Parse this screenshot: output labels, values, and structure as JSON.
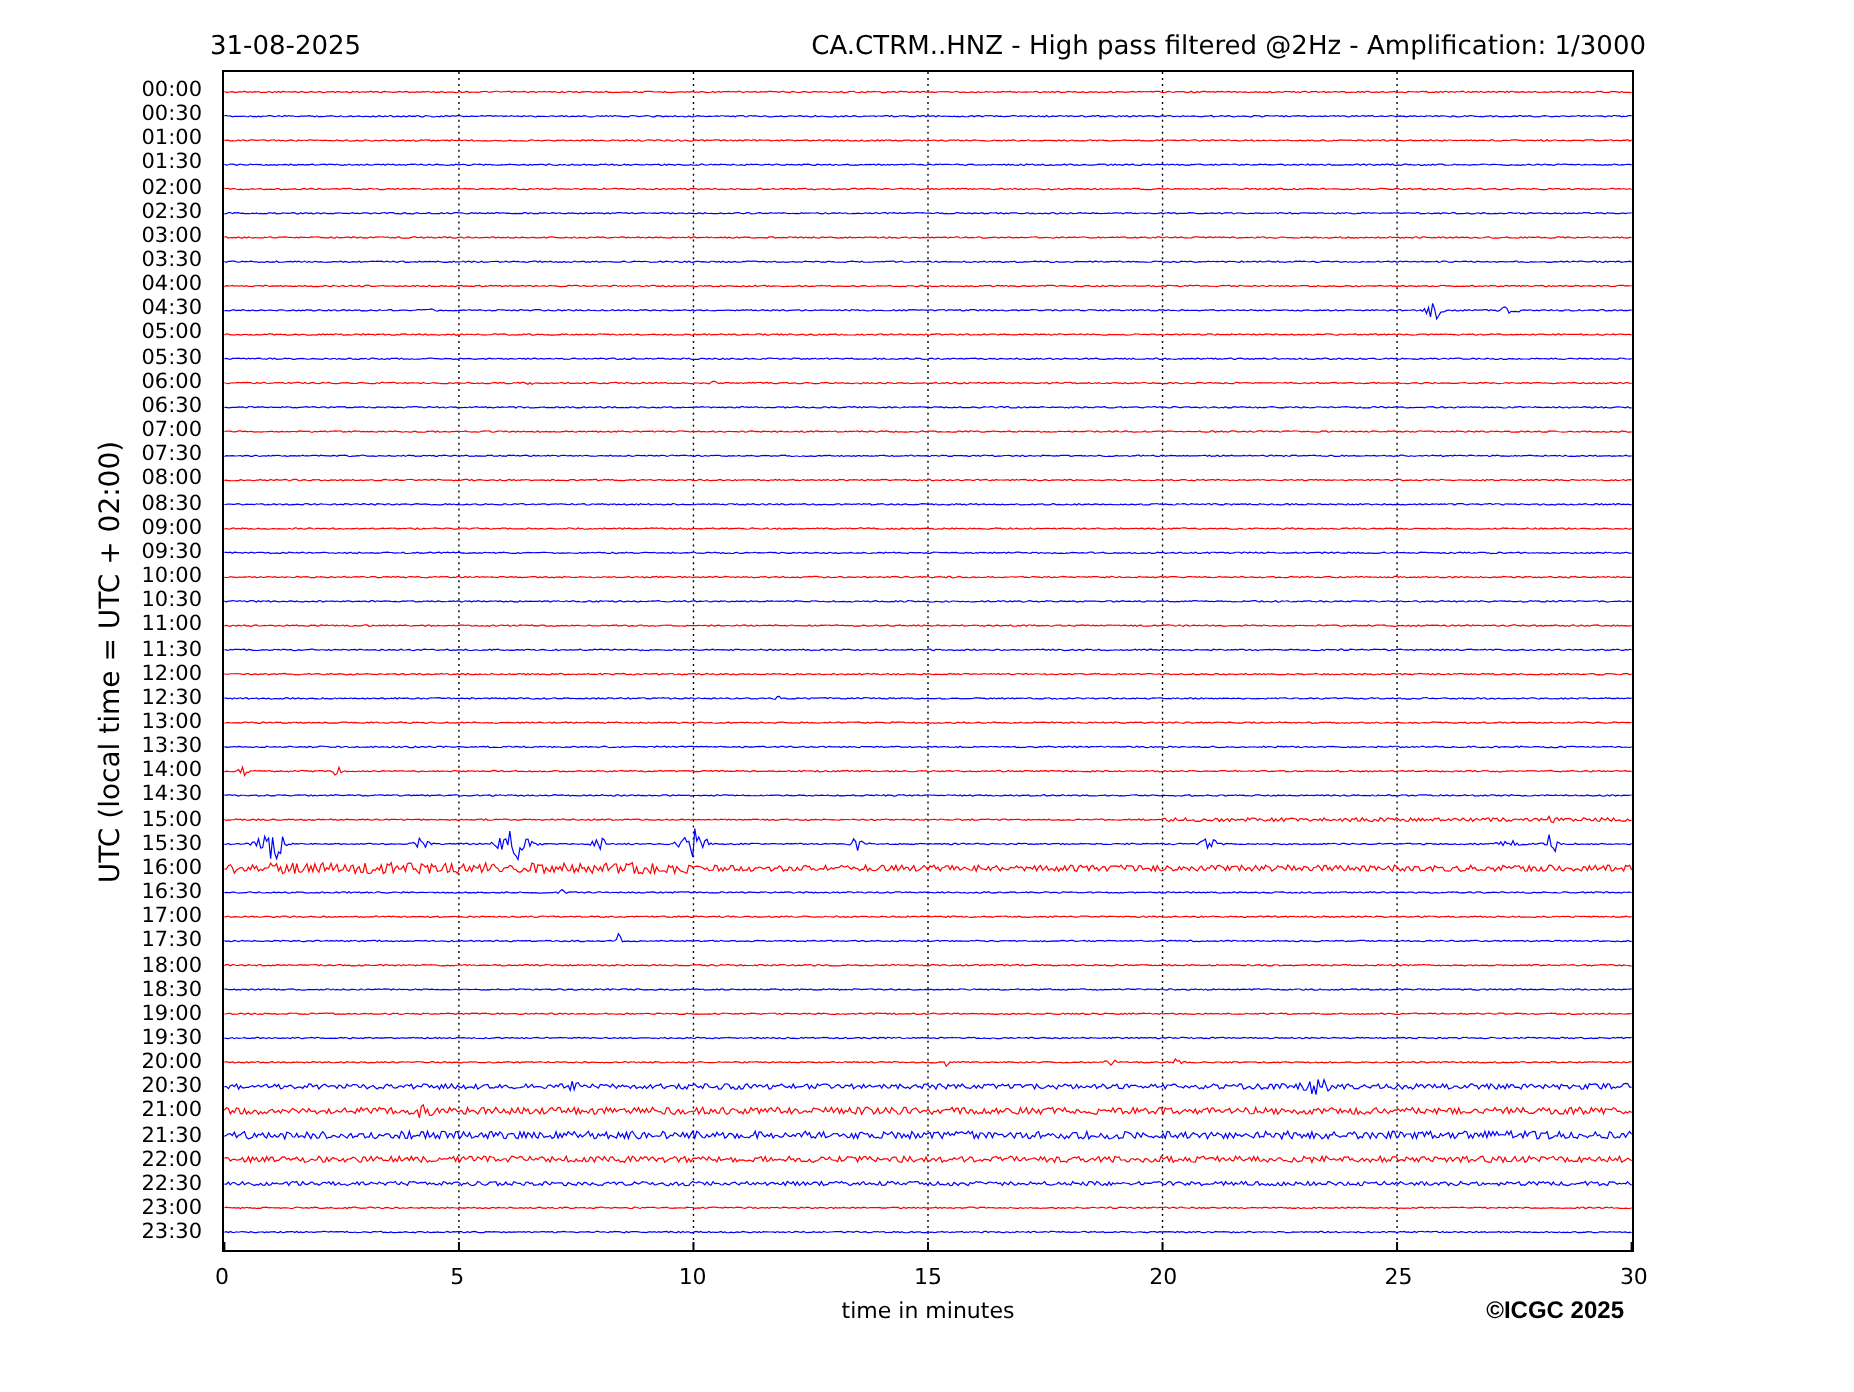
{
  "header": {
    "date": "31-08-2025",
    "title": "CA.CTRM..HNZ - High pass filtered @2Hz - Amplification: 1/3000"
  },
  "chart": {
    "ylabel": "UTC (local time = UTC + 02:00)",
    "xlabel": "time in minutes",
    "xticks": [
      "0",
      "5",
      "10",
      "15",
      "20",
      "25",
      "30"
    ],
    "rows": [
      {
        "label": "00:00",
        "color": "#ff0000"
      },
      {
        "label": "00:30",
        "color": "#0000ff"
      },
      {
        "label": "01:00",
        "color": "#ff0000"
      },
      {
        "label": "01:30",
        "color": "#0000ff"
      },
      {
        "label": "02:00",
        "color": "#ff0000"
      },
      {
        "label": "02:30",
        "color": "#0000ff"
      },
      {
        "label": "03:00",
        "color": "#ff0000"
      },
      {
        "label": "03:30",
        "color": "#0000ff"
      },
      {
        "label": "04:00",
        "color": "#ff0000"
      },
      {
        "label": "04:30",
        "color": "#0000ff"
      },
      {
        "label": "05:00",
        "color": "#ff0000"
      },
      {
        "label": "05:30",
        "color": "#0000ff"
      },
      {
        "label": "06:00",
        "color": "#ff0000"
      },
      {
        "label": "06:30",
        "color": "#0000ff"
      },
      {
        "label": "07:00",
        "color": "#ff0000"
      },
      {
        "label": "07:30",
        "color": "#0000ff"
      },
      {
        "label": "08:00",
        "color": "#ff0000"
      },
      {
        "label": "08:30",
        "color": "#0000ff"
      },
      {
        "label": "09:00",
        "color": "#ff0000"
      },
      {
        "label": "09:30",
        "color": "#0000ff"
      },
      {
        "label": "10:00",
        "color": "#ff0000"
      },
      {
        "label": "10:30",
        "color": "#0000ff"
      },
      {
        "label": "11:00",
        "color": "#ff0000"
      },
      {
        "label": "11:30",
        "color": "#0000ff"
      },
      {
        "label": "12:00",
        "color": "#ff0000"
      },
      {
        "label": "12:30",
        "color": "#0000ff"
      },
      {
        "label": "13:00",
        "color": "#ff0000"
      },
      {
        "label": "13:30",
        "color": "#0000ff"
      },
      {
        "label": "14:00",
        "color": "#ff0000"
      },
      {
        "label": "14:30",
        "color": "#0000ff"
      },
      {
        "label": "15:00",
        "color": "#ff0000"
      },
      {
        "label": "15:30",
        "color": "#0000ff"
      },
      {
        "label": "16:00",
        "color": "#ff0000"
      },
      {
        "label": "16:30",
        "color": "#0000ff"
      },
      {
        "label": "17:00",
        "color": "#ff0000"
      },
      {
        "label": "17:30",
        "color": "#0000ff"
      },
      {
        "label": "18:00",
        "color": "#ff0000"
      },
      {
        "label": "18:30",
        "color": "#0000ff"
      },
      {
        "label": "19:00",
        "color": "#ff0000"
      },
      {
        "label": "19:30",
        "color": "#0000ff"
      },
      {
        "label": "20:00",
        "color": "#ff0000"
      },
      {
        "label": "20:30",
        "color": "#0000ff"
      },
      {
        "label": "21:00",
        "color": "#ff0000"
      },
      {
        "label": "21:30",
        "color": "#0000ff"
      },
      {
        "label": "22:00",
        "color": "#ff0000"
      },
      {
        "label": "22:30",
        "color": "#0000ff"
      },
      {
        "label": "23:00",
        "color": "#ff0000"
      },
      {
        "label": "23:30",
        "color": "#0000ff"
      }
    ]
  },
  "copyright": "©ICGC 2025"
}
